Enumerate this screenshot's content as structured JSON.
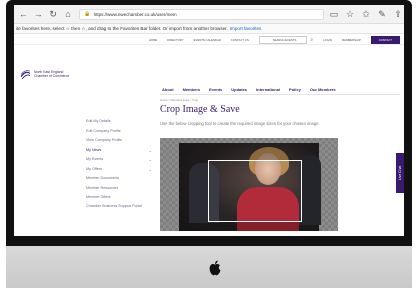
{
  "browser": {
    "url": "https://www.nwechamber.co.uk/user/mem",
    "favorites_bar_text": "ite favorites here, select ☆ then ☆, and drag to the Favorites Bar folder. Or import from another browser.",
    "favorites_import_link": "Import favorites"
  },
  "topnav": {
    "items": [
      "Home",
      "Directory",
      "Events Calendar",
      "Contact Us"
    ],
    "search_placeholder": "Search Events",
    "extra": [
      "Login",
      "Membership"
    ],
    "cta": "Contact"
  },
  "header": {
    "org_name_line1": "North East England",
    "org_name_line2": "Chamber of Commerce",
    "main_nav": [
      "About",
      "Members",
      "Events",
      "Updates",
      "International",
      "Policy",
      "Our Members"
    ]
  },
  "breadcrumb": "Home > Members Area > Crop",
  "page": {
    "title": "Crop Image & Save",
    "intro": "Use the below cropping tool to create the required image sizes for your chosen image."
  },
  "sidebar": {
    "items": [
      {
        "label": "Edit My Details",
        "active": false,
        "chevron": false
      },
      {
        "label": "Edit Company Profile",
        "active": false,
        "chevron": false
      },
      {
        "label": "View Company Profile",
        "active": false,
        "chevron": false
      },
      {
        "label": "My News",
        "active": true,
        "chevron": true
      },
      {
        "label": "My Events",
        "active": false,
        "chevron": true
      },
      {
        "label": "My Offers",
        "active": false,
        "chevron": true
      },
      {
        "label": "Member Documents",
        "active": false,
        "chevron": false
      },
      {
        "label": "Member Resources",
        "active": false,
        "chevron": false
      },
      {
        "label": "Member Offers",
        "active": false,
        "chevron": false
      },
      {
        "label": "Chamber Business Support Portal",
        "active": false,
        "chevron": false
      }
    ]
  },
  "live_chat": "Live Chat",
  "colors": {
    "brand": "#3a1a6e",
    "accent": "#b22b3a"
  }
}
